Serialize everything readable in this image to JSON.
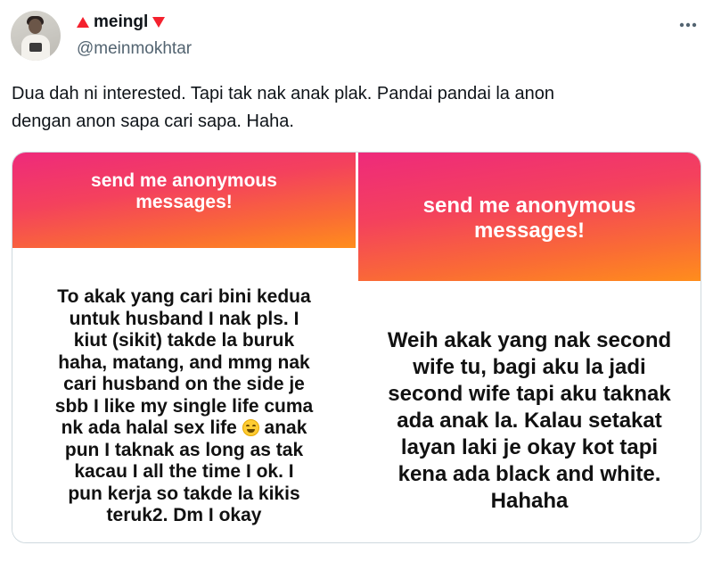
{
  "author": {
    "display_name": "meingl",
    "handle": "@meinmokhtar",
    "flair_left_icon": "red-triangle-up-icon",
    "flair_right_icon": "red-triangle-down-icon",
    "accent_color": "#f4212e"
  },
  "more_icon": "more-horizontal-icon",
  "tweet": {
    "text_line1": "Dua dah ni interested. Tapi tak nak anak plak. Pandai pandai la anon",
    "text_line2": "dengan anon sapa cari sapa. Haha."
  },
  "media": {
    "left": {
      "banner_line1": "send me anonymous",
      "banner_line2": "messages!",
      "message_lines": [
        "To akak yang cari bini kedua",
        "untuk husband I nak pls. I",
        "kiut (sikit) takde la buruk",
        "haha, matang, and mmg nak",
        "cari husband on the side je",
        "sbb I like my single life cuma",
        "nk ada halal sex life",
        "anak",
        "pun I taknak as long as tak",
        "kacau I all the time I ok. I",
        "pun kerja so takde la kikis",
        "teruk2. Dm I okay"
      ],
      "emoji": "grinning-squinting-face-icon"
    },
    "right": {
      "banner_line1": "send me anonymous",
      "banner_line2": "messages!",
      "message_lines": [
        "Weih akak yang nak second",
        "wife tu, bagi aku la jadi",
        "second wife tapi aku taknak",
        "ada anak la. Kalau setakat",
        "layan laki je okay kot tapi",
        "kena ada black and white.",
        "Hahaha"
      ]
    },
    "banner_gradient": [
      "#ee2a7b",
      "#f4415d",
      "#fa6b35",
      "#ff8d1c"
    ]
  }
}
